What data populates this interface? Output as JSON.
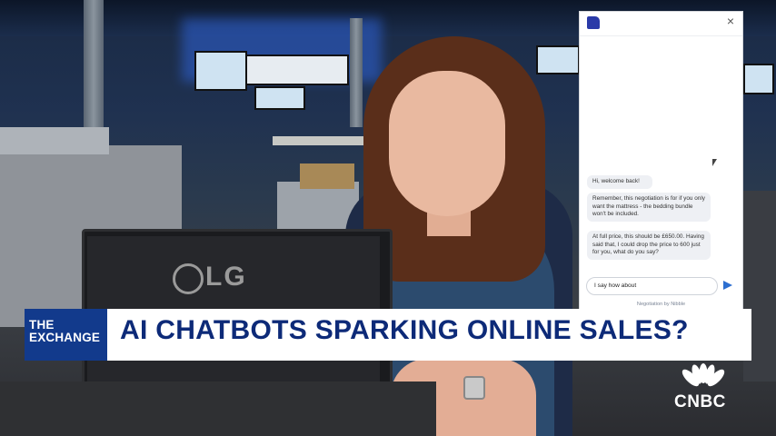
{
  "chat_widget": {
    "close_label": "×",
    "messages": [
      "Hi, welcome back!",
      "Remember, this negotiation is for if you only want the mattress - the bedding bundle won't be included.",
      "At full price, this should be £650.00. Having said that, I could drop the price to 600 just for you, what do you say?"
    ],
    "input_value": "I say how about",
    "powered_by": "Negotiation by Nibble",
    "colors": {
      "logo": "#2a3aa8",
      "send": "#2c6ed0",
      "bubble": "#eef0f4"
    }
  },
  "lower_third": {
    "brand_line1": "THE",
    "brand_line2": "EXCHANGE",
    "headline": "AI CHATBOTS SPARKING ONLINE SALES?",
    "colors": {
      "brand_bg": "#123a8c",
      "headline_text": "#0d2a78",
      "bar_bg": "#ffffff"
    }
  },
  "monitor": {
    "brand": "LG"
  },
  "network_logo": {
    "text": "CNBC",
    "icon": "peacock-icon"
  }
}
